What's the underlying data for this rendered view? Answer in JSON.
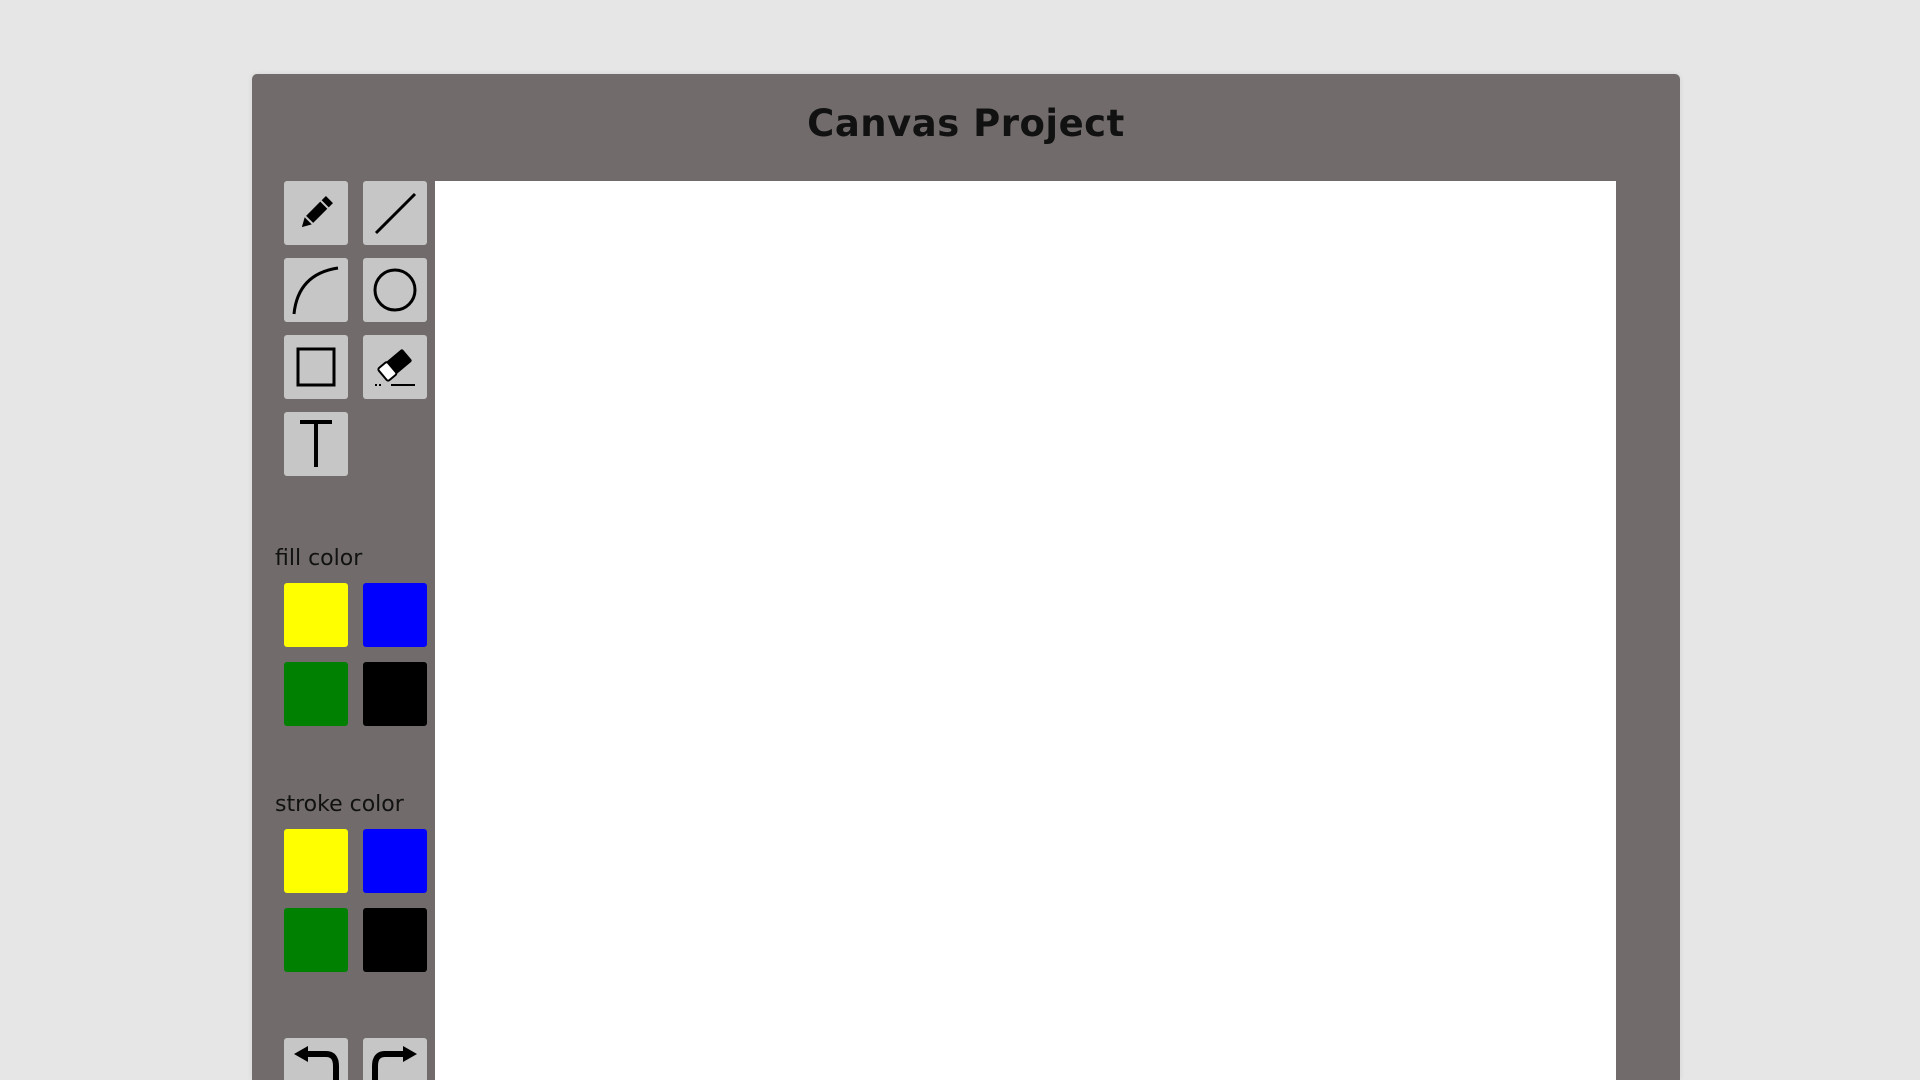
{
  "app": {
    "title": "Canvas Project"
  },
  "tools": [
    {
      "id": "pencil",
      "icon": "pencil-icon"
    },
    {
      "id": "line",
      "icon": "line-icon"
    },
    {
      "id": "curve",
      "icon": "curve-icon"
    },
    {
      "id": "circle",
      "icon": "circle-icon"
    },
    {
      "id": "rectangle",
      "icon": "rectangle-icon"
    },
    {
      "id": "eraser",
      "icon": "eraser-icon"
    },
    {
      "id": "text",
      "icon": "text-icon"
    }
  ],
  "fill_color": {
    "label": "fill color",
    "colors": [
      "#ffff00",
      "#0000ff",
      "#008000",
      "#000000"
    ]
  },
  "stroke_color": {
    "label": "stroke color",
    "colors": [
      "#ffff00",
      "#0000ff",
      "#008000",
      "#000000"
    ]
  },
  "history": [
    {
      "id": "undo",
      "icon": "undo-icon"
    },
    {
      "id": "redo",
      "icon": "redo-icon"
    }
  ],
  "colors": {
    "page_background": "#e6e6e6",
    "panel_background": "#716b6b",
    "button_background": "#c6c6c6",
    "canvas_background": "#ffffff"
  }
}
